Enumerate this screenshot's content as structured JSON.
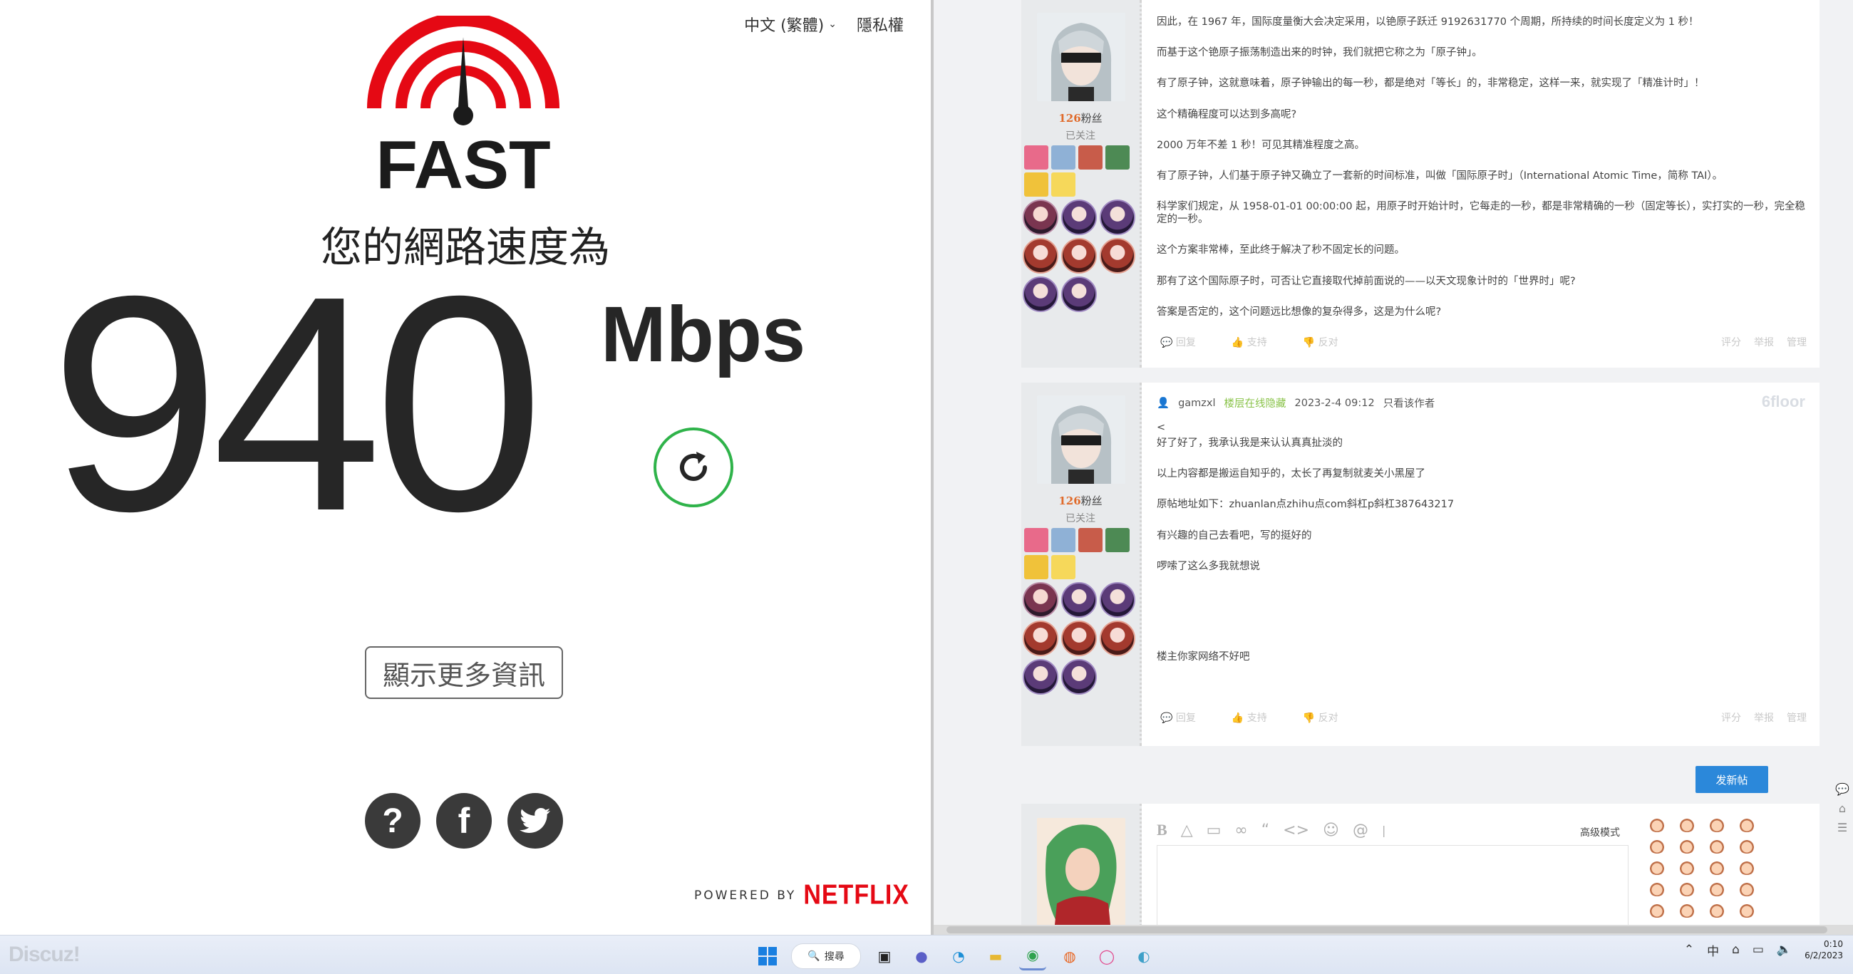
{
  "fast": {
    "language": "中文 (繁體)",
    "privacy": "隱私權",
    "logo_text": "FAST",
    "heading": "您的網路速度為",
    "speed_value": "940",
    "speed_units": "Mbps",
    "more_info": "顯示更多資訊",
    "powered_by": "POWERED BY",
    "netflix": "NETFLIX",
    "brand_red": "#e50914",
    "refresh_green": "#2fb34a",
    "social": [
      "help-icon",
      "facebook-icon",
      "twitter-icon"
    ]
  },
  "forum": {
    "post1": {
      "fans_count": "126",
      "fans_label": "粉丝",
      "followed": "已关注",
      "paragraphs": [
        "因此，在 1967 年，国际度量衡大会决定采用，以铯原子跃迁 9192631770 个周期，所持续的时间长度定义为 1 秒！",
        "而基于这个铯原子振荡制造出来的时钟，我们就把它称之为「原子钟」。",
        "有了原子钟，这就意味着，原子钟输出的每一秒，都是绝对「等长」的，非常稳定，这样一来，就实现了「精准计时」！",
        "这个精确程度可以达到多高呢?",
        "2000 万年不差 1 秒！可见其精准程度之高。",
        "有了原子钟，人们基于原子钟又确立了一套新的时间标准，叫做「国际原子时」（International Atomic Time，简称 TAI）。",
        "科学家们规定，从 1958-01-01 00:00:00 起，用原子时开始计时，它每走的一秒，都是非常精确的一秒（固定等长），实打实的一秒，完全稳定的一秒。",
        "这个方案非常棒，至此终于解决了秒不固定长的问题。",
        "那有了这个国际原子时，可否让它直接取代掉前面说的——以天文现象计时的「世界时」呢?",
        "答案是否定的，这个问题远比想像的复杂得多，这是为什么呢?"
      ],
      "actions": [
        "回复",
        "支持",
        "反对"
      ],
      "right_actions": [
        "评分",
        "举报",
        "管理"
      ]
    },
    "post2": {
      "author": "gamzxl",
      "status": "楼层在线隐藏",
      "date": "2023-2-4 09:12",
      "only_author": "只看该作者",
      "floor": "6floor",
      "fans_count": "126",
      "fans_label": "粉丝",
      "followed": "已关注",
      "paragraphs": [
        "<",
        "好了好了，我承认我是来认认真真扯淡的",
        "以上内容都是搬运自知乎的，太长了再复制就麦关小黑屋了",
        "原帖地址如下：zhuanlan点zhihu点com斜杠p斜杠387643217",
        "有兴趣的自己去看吧，写的挺好的",
        "啰嗦了这么多我就想说"
      ],
      "last_paragraph": "楼主你家网络不好吧",
      "actions": [
        "回复",
        "支持",
        "反对"
      ],
      "right_actions": [
        "评分",
        "举报",
        "管理"
      ]
    },
    "new_post_button": "发新帖",
    "editor_advanced": "高级模式",
    "accent_blue": "#2b88da"
  },
  "taskbar": {
    "watermark": "Discuz!",
    "search_label": "搜尋",
    "lang_indicator": "中",
    "time": "0:10",
    "date": "6/2/2023"
  }
}
